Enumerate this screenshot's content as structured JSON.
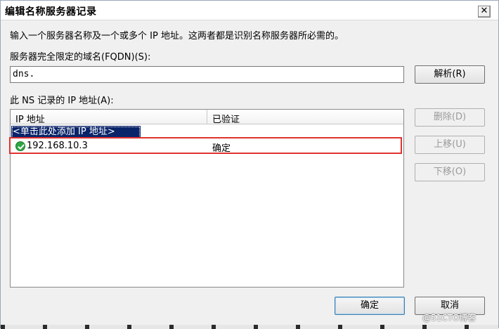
{
  "window": {
    "title": "编辑名称服务器记录",
    "close_label": "✕"
  },
  "description": "输入一个服务器名称及一个或多个 IP 地址。这两者都是识别名称服务器所必需的。",
  "fqdn": {
    "label": "服务器完全限定的域名(FQDN)(S):",
    "value": "dns.",
    "resolve_button": "解析(R)"
  },
  "ip_list": {
    "label": "此 NS 记录的 IP 地址(A):",
    "columns": [
      "IP 地址",
      "已验证"
    ],
    "add_prompt": "<单击此处添加 IP 地址>",
    "rows": [
      {
        "ip": "192.168.10.3",
        "verified": "确定",
        "status_icon": "check-circle-icon"
      }
    ]
  },
  "side_buttons": {
    "delete": "删除(D)",
    "move_up": "上移(U)",
    "move_down": "下移(O)"
  },
  "footer": {
    "ok": "确定",
    "cancel": "取消"
  },
  "watermark": "@51CTO博客",
  "colors": {
    "highlight": "#e0322f",
    "selection": "#0a246a",
    "ok_icon": "#2fa544"
  }
}
